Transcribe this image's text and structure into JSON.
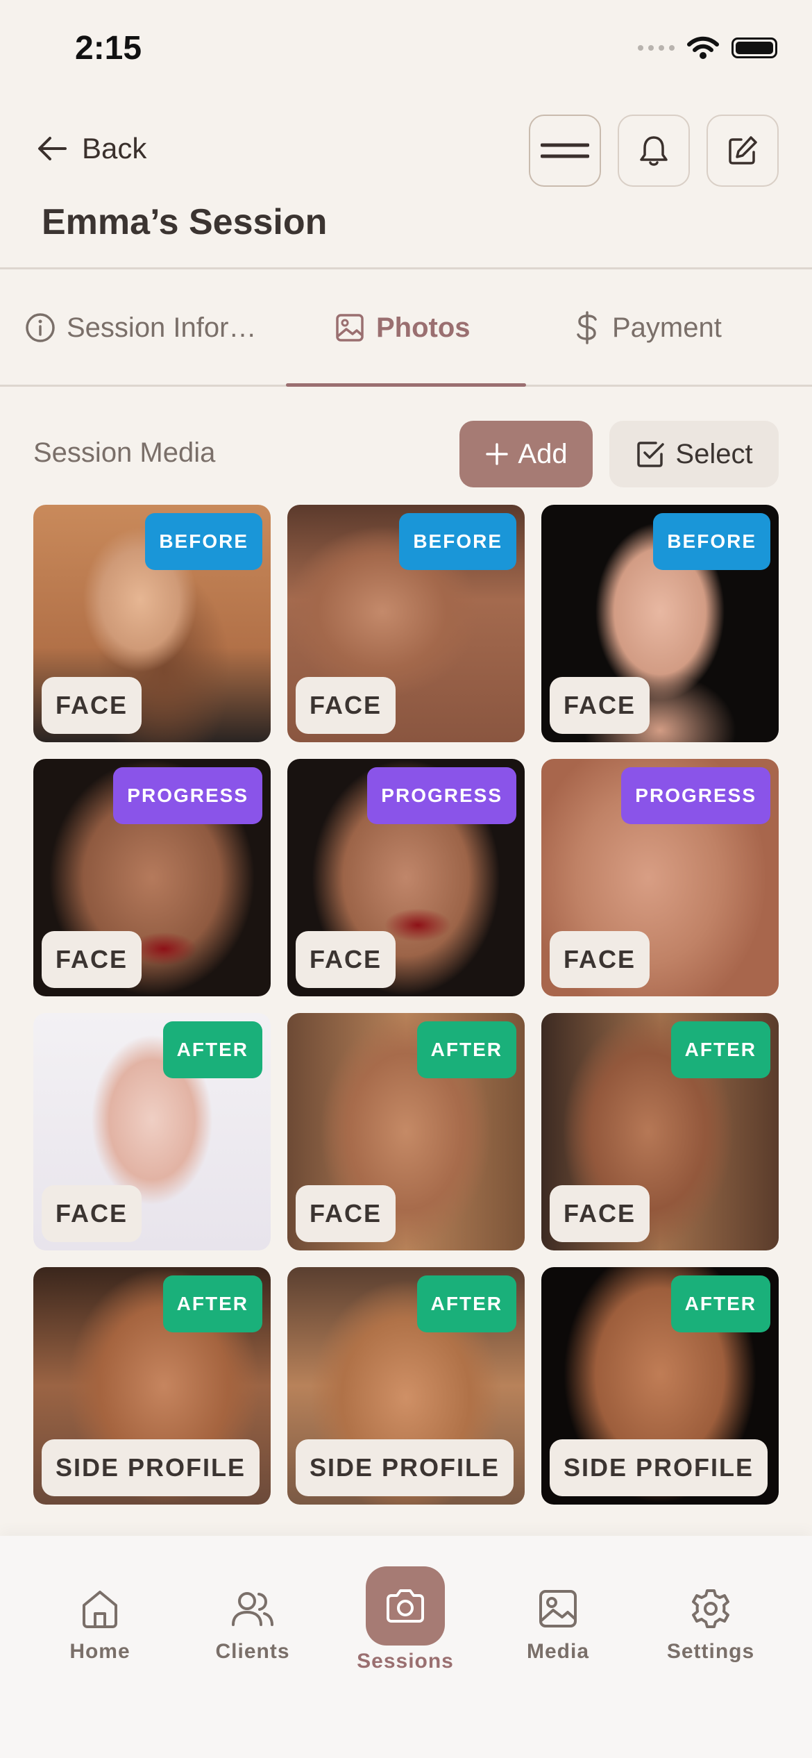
{
  "status": {
    "time": "2:15"
  },
  "header": {
    "back_label": "Back",
    "title": "Emma’s Session"
  },
  "tabs": [
    {
      "label": "Session Infor…",
      "icon": "info-icon"
    },
    {
      "label": "Photos",
      "icon": "image-icon",
      "active": true
    },
    {
      "label": "Payment",
      "icon": "dollar-icon"
    }
  ],
  "media": {
    "section_title": "Session Media",
    "add_label": "Add",
    "select_label": "Select"
  },
  "photos": [
    {
      "badge": "BEFORE",
      "badge_type": "before",
      "label": "FACE"
    },
    {
      "badge": "BEFORE",
      "badge_type": "before",
      "label": "FACE"
    },
    {
      "badge": "BEFORE",
      "badge_type": "before",
      "label": "FACE"
    },
    {
      "badge": "PROGRESS",
      "badge_type": "progress",
      "label": "FACE"
    },
    {
      "badge": "PROGRESS",
      "badge_type": "progress",
      "label": "FACE"
    },
    {
      "badge": "PROGRESS",
      "badge_type": "progress",
      "label": "FACE"
    },
    {
      "badge": "AFTER",
      "badge_type": "after",
      "label": "FACE"
    },
    {
      "badge": "AFTER",
      "badge_type": "after",
      "label": "FACE"
    },
    {
      "badge": "AFTER",
      "badge_type": "after",
      "label": "FACE"
    },
    {
      "badge": "AFTER",
      "badge_type": "after",
      "label": "SIDE PROFILE"
    },
    {
      "badge": "AFTER",
      "badge_type": "after",
      "label": "SIDE PROFILE"
    },
    {
      "badge": "AFTER",
      "badge_type": "after",
      "label": "SIDE PROFILE"
    }
  ],
  "nav": [
    {
      "label": "Home",
      "icon": "home-icon"
    },
    {
      "label": "Clients",
      "icon": "users-icon"
    },
    {
      "label": "Sessions",
      "icon": "camera-icon",
      "active": true
    },
    {
      "label": "Media",
      "icon": "image-icon"
    },
    {
      "label": "Settings",
      "icon": "gear-icon"
    }
  ],
  "colors": {
    "accent": "#a67b74",
    "before": "#1a96d8",
    "progress": "#8a54e9",
    "after": "#1ab07a",
    "background": "#f6f2ed"
  }
}
